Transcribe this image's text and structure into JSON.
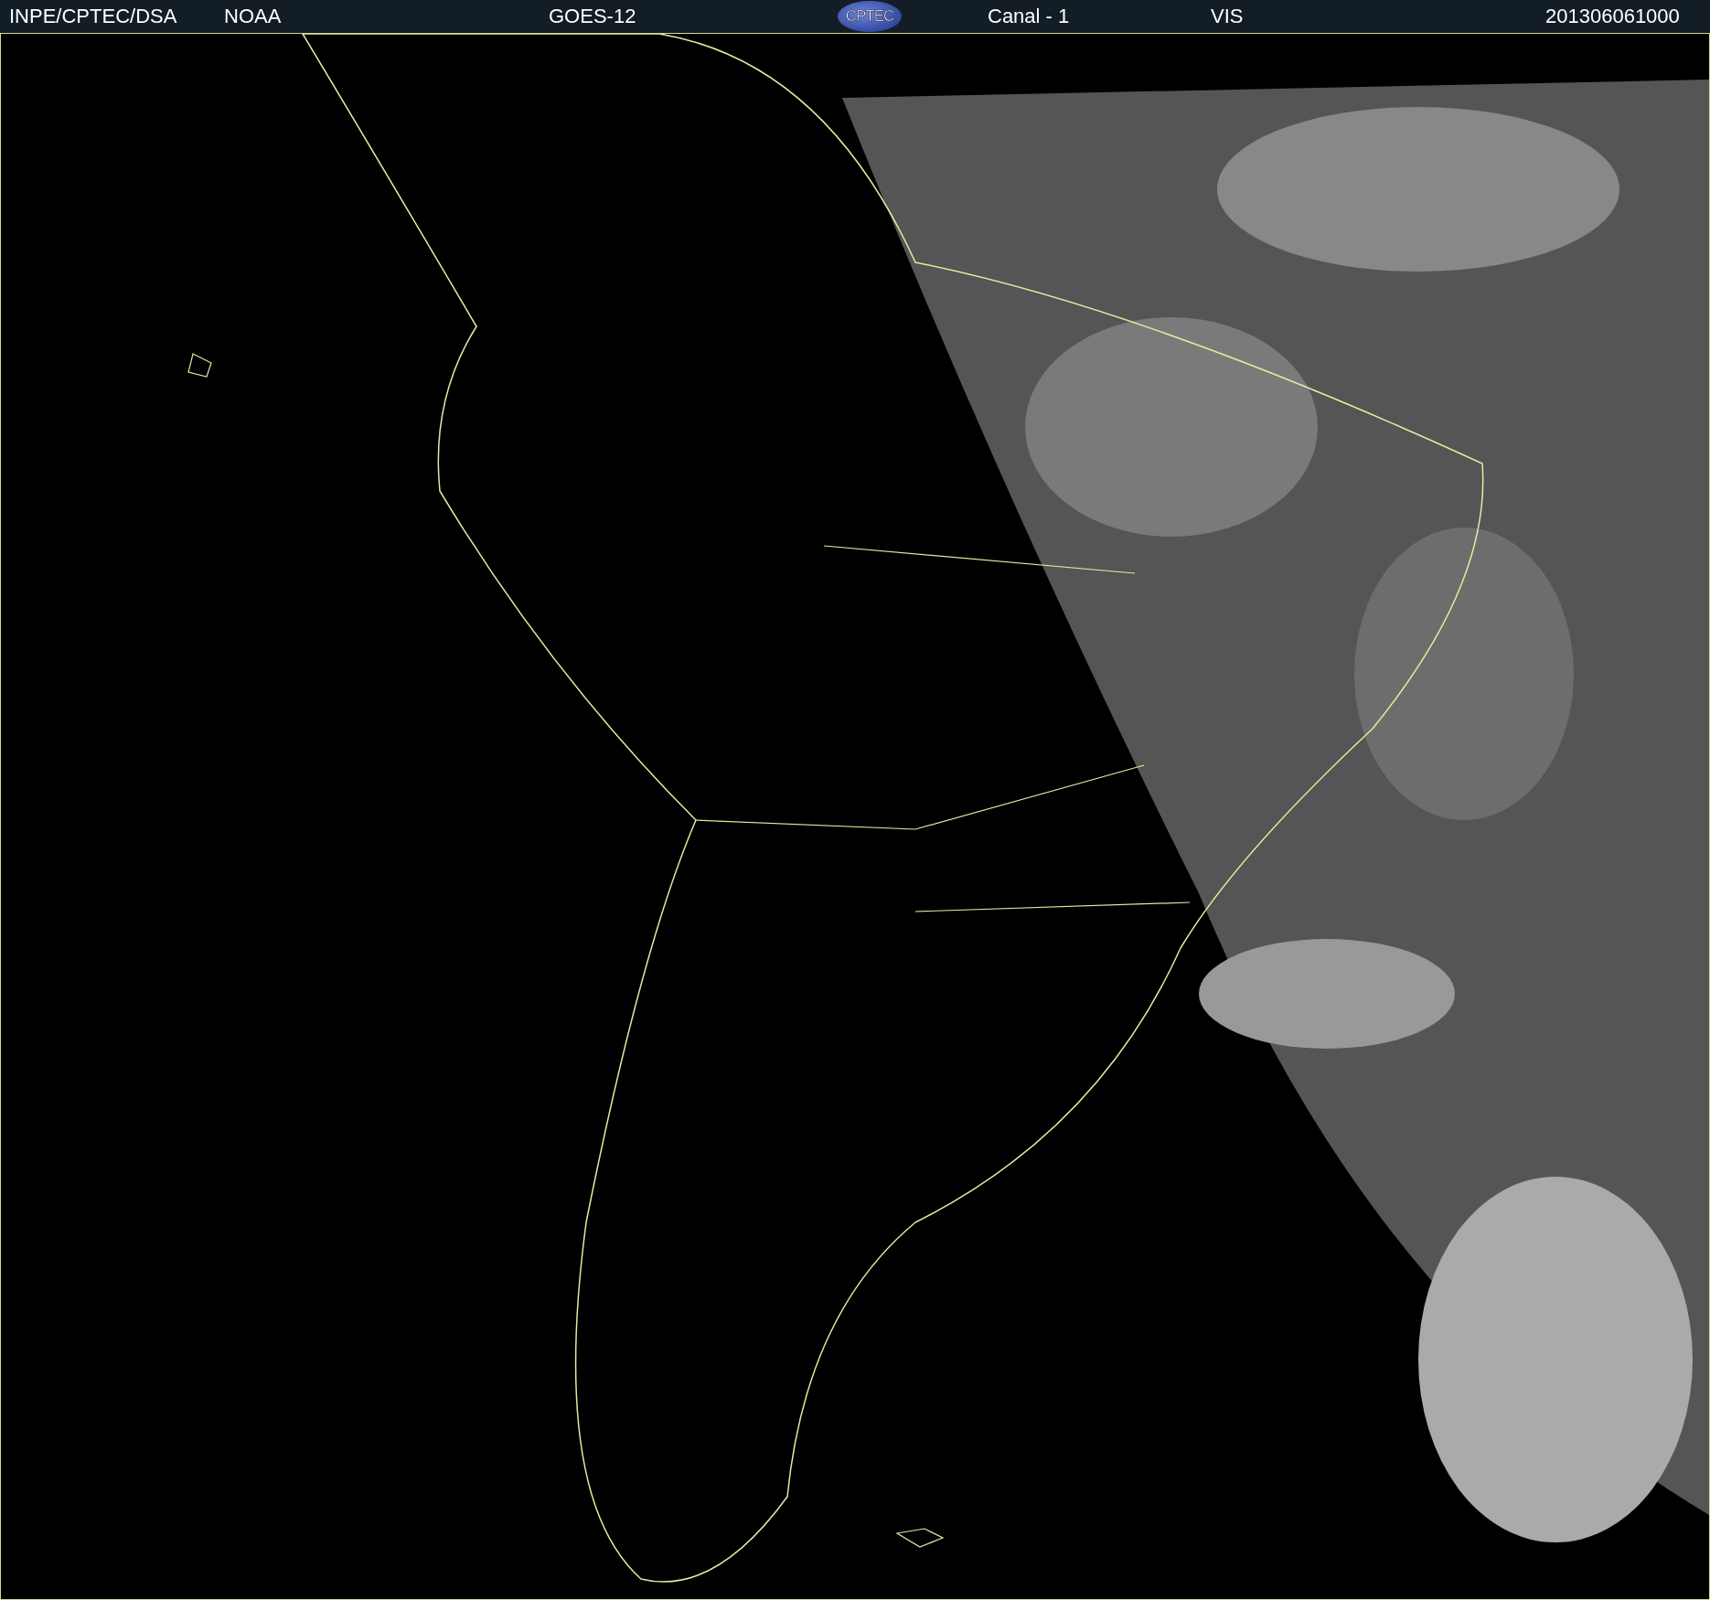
{
  "header": {
    "items": [
      {
        "kind": "text",
        "text": "INPE/CPTEC/DSA"
      },
      {
        "kind": "text",
        "text": "NOAA"
      },
      {
        "kind": "text",
        "text": "GOES-12"
      },
      {
        "kind": "logo",
        "text": "CPTEC"
      },
      {
        "kind": "text",
        "text": "Canal - 1"
      },
      {
        "kind": "text",
        "text": "VIS"
      },
      {
        "kind": "text",
        "text": "201306061000"
      }
    ]
  }
}
